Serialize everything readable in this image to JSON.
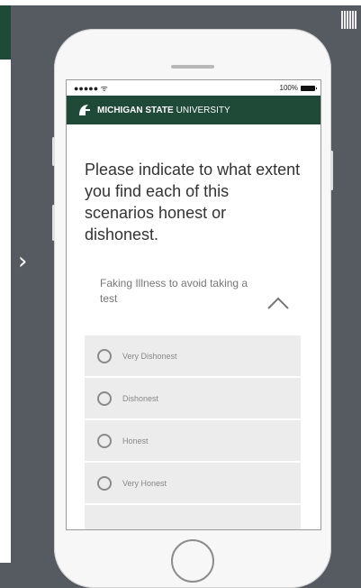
{
  "status_bar": {
    "signal": "●●●●● ᯤ",
    "battery": "100%"
  },
  "header": {
    "brand_bold": "MICHIGAN STATE",
    "brand_light": "UNIVERSITY"
  },
  "survey": {
    "question": "Please indicate to what extent you find each of this scenarios honest or dishonest.",
    "item": "Faking Illness to avoid taking a test",
    "options": [
      "Very Dishonest",
      "Dishonest",
      "Honest",
      "Very Honest"
    ]
  },
  "nav": {
    "next_glyph": "›"
  },
  "colors": {
    "brand_green": "#1f4a38",
    "background": "#555b60",
    "option_bg": "#ececec"
  },
  "icons": [
    "spartan-helmet-icon",
    "wifi-icon",
    "battery-icon",
    "chevron-up-icon",
    "chevron-right-icon",
    "qr-code-icon"
  ]
}
